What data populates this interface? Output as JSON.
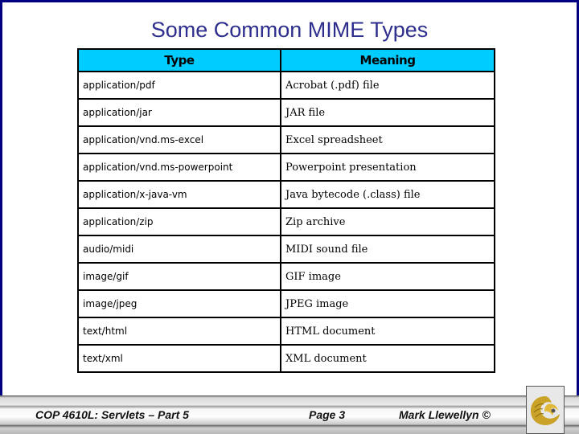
{
  "slide": {
    "title": "Some Common MIME Types",
    "table": {
      "headers": [
        "Type",
        "Meaning"
      ],
      "rows": [
        {
          "type": "application/pdf",
          "meaning": "Acrobat (.pdf) file"
        },
        {
          "type": "application/jar",
          "meaning": "JAR file"
        },
        {
          "type": "application/vnd.ms-excel",
          "meaning": "Excel spreadsheet"
        },
        {
          "type": "application/vnd.ms-powerpoint",
          "meaning": "Powerpoint presentation"
        },
        {
          "type": "application/x-java-vm",
          "meaning": "Java bytecode (.class) file"
        },
        {
          "type": "application/zip",
          "meaning": "Zip archive"
        },
        {
          "type": "audio/midi",
          "meaning": "MIDI sound file"
        },
        {
          "type": "image/gif",
          "meaning": "GIF image"
        },
        {
          "type": "image/jpeg",
          "meaning": "JPEG image"
        },
        {
          "type": "text/html",
          "meaning": "HTML document"
        },
        {
          "type": "text/xml",
          "meaning": "XML document"
        }
      ]
    }
  },
  "footer": {
    "course": "COP 4610L: Servlets – Part 5",
    "page": "Page 3",
    "author": "Mark Llewellyn ©",
    "logo_icon": "ucf-pegasus-logo-icon"
  },
  "colors": {
    "title": "#2e2e8f",
    "header_bg": "#00ccff",
    "frame_border": "#000080",
    "logo_gold": "#c9a227"
  }
}
